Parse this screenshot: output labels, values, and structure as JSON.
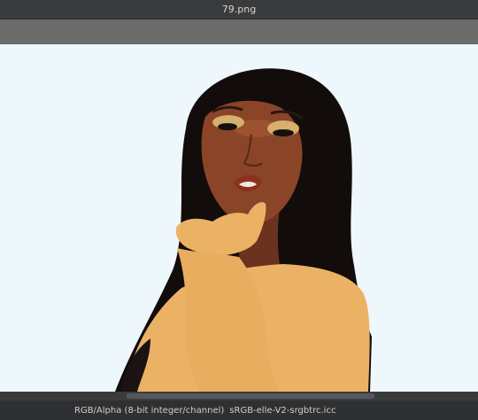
{
  "window": {
    "title": "79.png"
  },
  "status": {
    "color_mode": "RGB/Alpha (8-bit integer/channel)",
    "color_profile": "sRGB-elle-V2-srgbtrc.icc"
  },
  "canvas": {
    "background_color": "#eef7fb",
    "content": "digital-illustration"
  }
}
